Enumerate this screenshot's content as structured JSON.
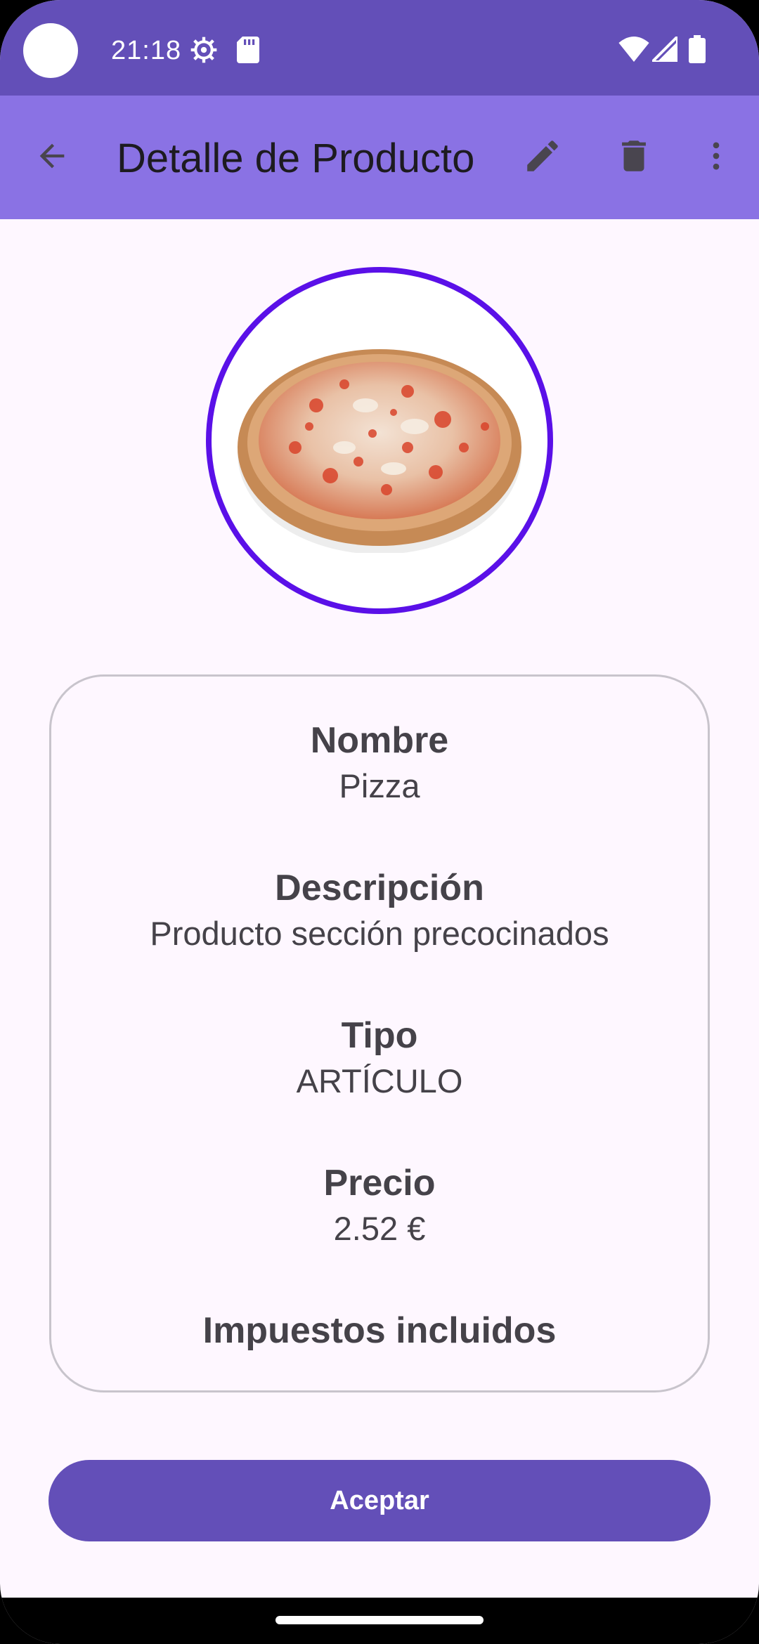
{
  "status_bar": {
    "time": "21:18",
    "icons": [
      "settings-gear-icon",
      "sd-card-icon",
      "wifi-icon",
      "signal-icon",
      "battery-icon"
    ]
  },
  "app_bar": {
    "title": "Detalle de Producto",
    "icons": [
      "back-arrow-icon",
      "edit-pencil-icon",
      "delete-trash-icon",
      "more-vert-icon"
    ]
  },
  "product": {
    "image": "pizza-image",
    "fields": [
      {
        "label": "Nombre",
        "value": "Pizza"
      },
      {
        "label": "Descripción",
        "value": "Producto sección precocinados"
      },
      {
        "label": "Tipo",
        "value": "ARTÍCULO"
      },
      {
        "label": "Precio",
        "value": "2.52 €"
      },
      {
        "label": "Impuestos incluidos",
        "value": ""
      }
    ]
  },
  "actions": {
    "accept_label": "Aceptar"
  },
  "colors": {
    "status_bar": "#634FB8",
    "app_bar": "#8A72E4",
    "image_ring": "#5A10E8",
    "primary_button": "#634FB8",
    "background": "#FEF7FF"
  }
}
